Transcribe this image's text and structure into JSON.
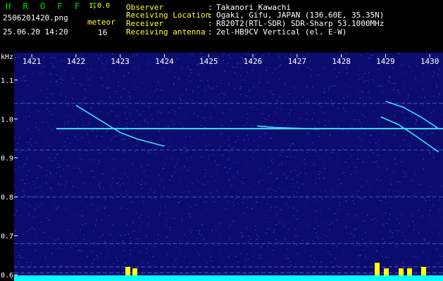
{
  "header": {
    "brand": "H R O F F T",
    "version": "1.0.0",
    "filename": "2506201420.png",
    "datetime": "25.06.20 14:20",
    "meteor_label": "meteor",
    "meteor_count": "16"
  },
  "info": [
    {
      "label": "Observer",
      "value": "Takanori Kawachi"
    },
    {
      "label": "Receiving Location",
      "value": "Ogaki, Gifu, JAPAN (136.60E, 35.35N)"
    },
    {
      "label": "Receiver",
      "value": "R820T2(RTL-SDR) SDR-Sharp 53.1000MHz"
    },
    {
      "label": "Receiving antenna",
      "value": "2el-HB9CV Vertical (el. E-W)"
    }
  ],
  "colors": {
    "header_green": "#00e000",
    "label_yellow": "#ffff30",
    "plot_background": "#0c0c6e",
    "signal_cyan": "#40e0ff",
    "level_bar_cyan": "#00ffff",
    "level_peak_yellow": "#ffff00"
  },
  "icons": [
    "waterfall-spectrogram"
  ],
  "chart_data": {
    "type": "heatmap",
    "xlabel": "",
    "ylabel": "kHz",
    "x_ticks": [
      "1421",
      "1422",
      "1423",
      "1424",
      "1425",
      "1426",
      "1427",
      "1428",
      "1429",
      "1430"
    ],
    "y_ticks": [
      "1.1",
      "1.0",
      "0.9",
      "0.8",
      "0.7",
      "0.6"
    ],
    "xlim": [
      1420.6,
      1430.3
    ],
    "ylim": [
      0.584,
      1.17
    ],
    "carrier_khz": 0.975,
    "interference_lines_khz": [
      1.04,
      0.92,
      0.8,
      0.68,
      0.62,
      0.605
    ],
    "meteor_traces": [
      {
        "x": [
          1422.0,
          1422.5,
          1423.0,
          1423.4,
          1424.0
        ],
        "y": [
          1.035,
          1.0,
          0.965,
          0.948,
          0.93
        ]
      },
      {
        "x": [
          1428.9,
          1429.3,
          1429.7,
          1430.2
        ],
        "y": [
          1.005,
          0.985,
          0.955,
          0.915
        ]
      },
      {
        "x": [
          1429.0,
          1429.4,
          1429.8,
          1430.2
        ],
        "y": [
          1.045,
          1.03,
          1.005,
          0.975
        ]
      },
      {
        "x": [
          1426.1,
          1426.5,
          1427.0,
          1427.5
        ],
        "y": [
          0.982,
          0.978,
          0.976,
          0.974
        ]
      }
    ]
  }
}
